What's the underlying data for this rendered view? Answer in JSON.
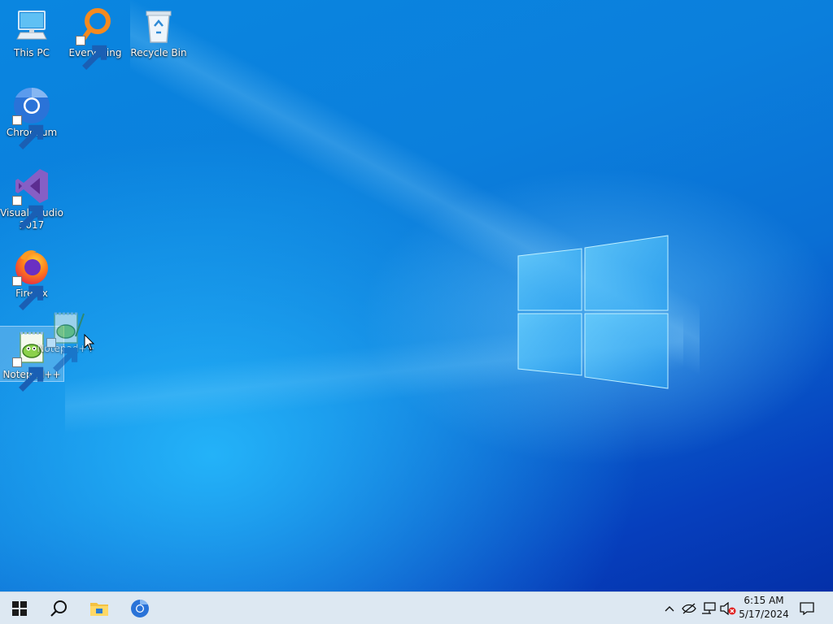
{
  "desktop": {
    "icons": [
      {
        "name": "this-pc",
        "label": "This PC",
        "icon": "computer-icon"
      },
      {
        "name": "everything",
        "label": "Everything",
        "icon": "magnifier-icon"
      },
      {
        "name": "recycle-bin",
        "label": "Recycle Bin",
        "icon": "recycle-bin-icon"
      },
      {
        "name": "chromium",
        "label": "Chromium",
        "icon": "chromium-icon"
      },
      {
        "name": "visual-studio",
        "label": "Visual Studio 2017",
        "icon": "visual-studio-icon"
      },
      {
        "name": "firefox",
        "label": "Firefox",
        "icon": "firefox-icon"
      },
      {
        "name": "notepad-plus-plus",
        "label": "Notepad++",
        "icon": "notepad-plus-plus-icon"
      }
    ],
    "drag_ghost": {
      "label": "Notepad++",
      "icon": "notepad-plus-plus-icon"
    }
  },
  "taskbar": {
    "start": "windows-start-icon",
    "search": "search-icon",
    "pinned": [
      "file-explorer-icon",
      "chromium-icon"
    ],
    "tray": {
      "icons": [
        "chevron-up-icon",
        "network-disconnected-icon",
        "monitor-network-icon",
        "speaker-muted-icon"
      ],
      "time": "6:15 AM",
      "date": "5/17/2024",
      "notification": "action-center-icon"
    }
  },
  "colors": {
    "desktop_accent": "#0a78d7",
    "taskbar_bg": "#dde8f2"
  }
}
